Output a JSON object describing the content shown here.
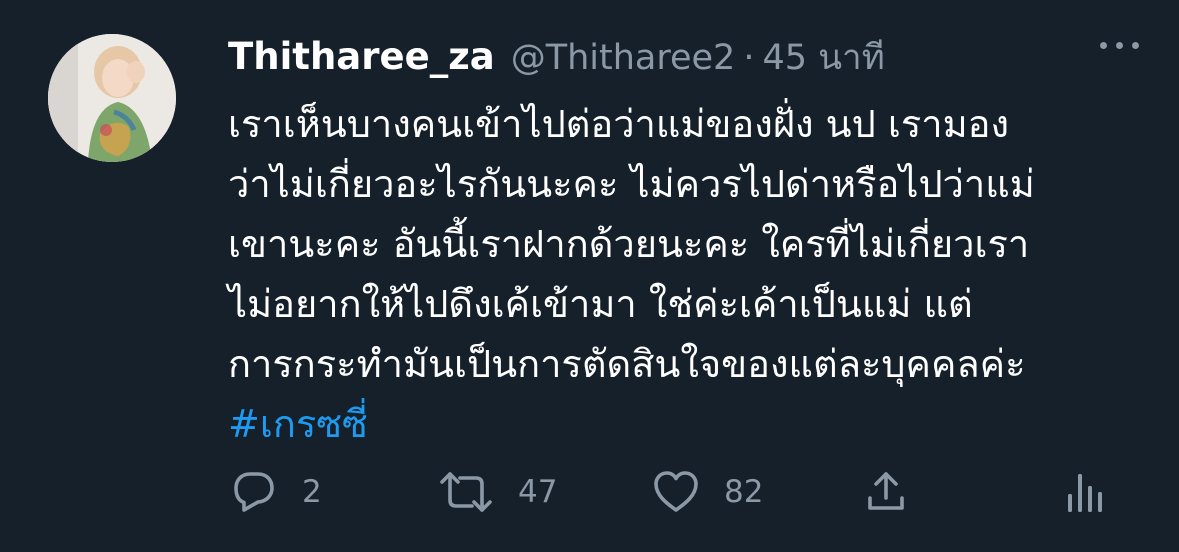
{
  "tweet": {
    "display_name": "Thitharee_za",
    "handle": "@Thitharee2",
    "separator": "·",
    "time": "45 นาที",
    "lines": [
      "เราเห็นบางคนเข้าไปต่อว่าแม่ของฝั่ง นป เรามอง",
      "ว่าไม่เกี่ยวอะไรกันนะคะ ไม่ควรไปด่าหรือไปว่าแม่",
      "เขานะคะ อันนี้เราฝากด้วยนะคะ ใครที่ไม่เกี่ยวเรา",
      "ไม่อยากให้ไปดึงเค้เข้ามา ใช่ค่ะเค้าเป็นแม่ แต่",
      "การกระทำมันเป็นการตัดสินใจของแต่ละบุคคลค่ะ"
    ],
    "hashtag": "#เกรซซี่"
  },
  "actions": {
    "reply_count": "2",
    "retweet_count": "47",
    "like_count": "82"
  },
  "icons": {
    "more": "more-dots-icon",
    "reply": "reply-bubble-icon",
    "retweet": "retweet-arrows-icon",
    "like": "heart-icon",
    "share": "share-upload-icon",
    "analytics": "analytics-bars-icon"
  },
  "colors": {
    "background": "#15202b",
    "text": "#ffffff",
    "muted": "#8b98a5",
    "link": "#1d9bf0"
  }
}
